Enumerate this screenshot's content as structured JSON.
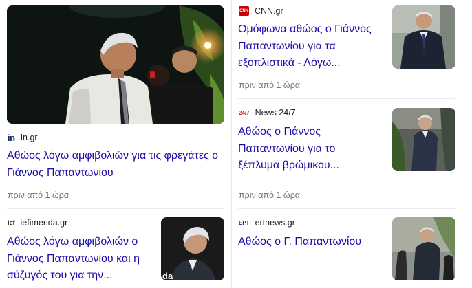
{
  "cards": [
    {
      "source": "In.gr",
      "logo_text": "in",
      "headline_line1": "Αθώος λόγω αμφιβολιών για τις φρεγάτες ο",
      "headline_line2": "Γιάννος Παπαντωνίου",
      "time": "πριν από 1 ώρα"
    },
    {
      "source": "CNN.gr",
      "logo_text": "CNN",
      "headline_line1": "Ομόφωνα αθώος ο Γιάννος",
      "headline_line2": "Παπαντωνίου για τα",
      "headline_line3": "εξοπλιστικά - Λόγω...",
      "time": "πριν από 1 ώρα"
    },
    {
      "source": "News 24/7",
      "logo_text": "24/7",
      "headline_line1": "Αθώος ο Γιάννος",
      "headline_line2": "Παπαντωνίου για το",
      "headline_line3": "ξέπλυμα βρώμικου...",
      "time": "πριν από 1 ώρα"
    },
    {
      "source": "iefimerida.gr",
      "logo_text": "ief",
      "headline_line1": "Αθώος λόγω αμφιβολιών ο",
      "headline_line2": "Γιάννος Παπαντωνίου και η",
      "headline_line3": "σύζυγός του για την...",
      "thumb_overlay": "da"
    },
    {
      "source": "ertnews.gr",
      "logo_text": "ΕΡΤ",
      "headline_line1": "Αθώος ο Γ. Παπαντωνίου"
    }
  ],
  "colors": {
    "headline": "#1a0dab",
    "meta": "#70757a",
    "divider": "#e8eaed"
  }
}
